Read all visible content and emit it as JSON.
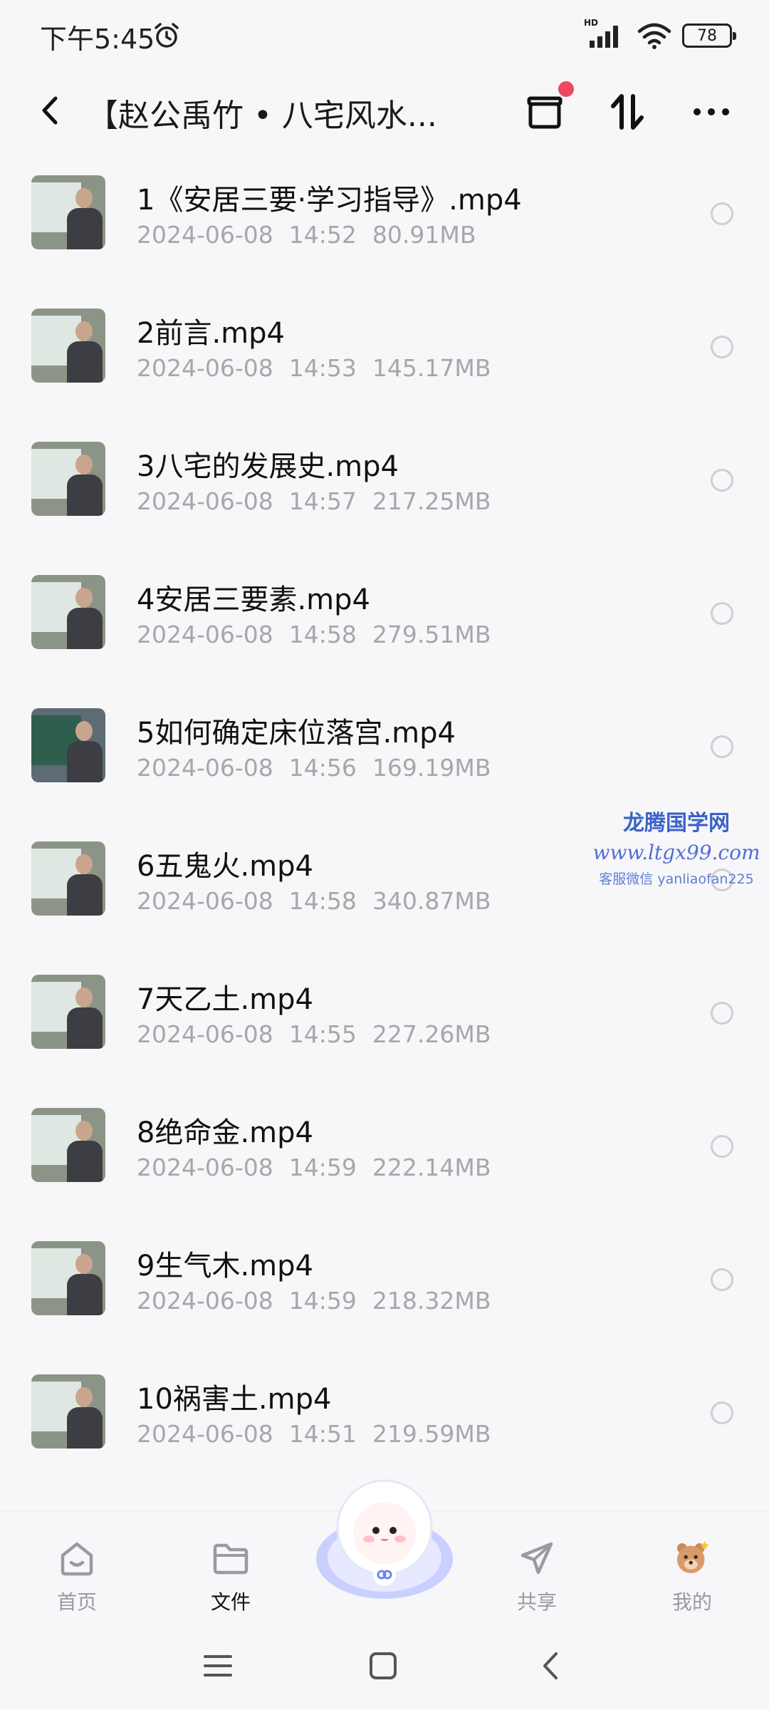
{
  "status_bar": {
    "time": "下午5:45",
    "network_label": "HD",
    "battery": "78"
  },
  "header": {
    "title": "【赵公禹竹 • 八宅风水...",
    "icons": [
      "back-arrow-icon",
      "archive-box-icon",
      "sort-icon",
      "more-icon"
    ],
    "badge_color": "#f0485f"
  },
  "files": [
    {
      "name": "1《安居三要·学习指导》.mp4",
      "date": "2024-06-08",
      "time": "14:52",
      "size": "80.91MB"
    },
    {
      "name": "2前言.mp4",
      "date": "2024-06-08",
      "time": "14:53",
      "size": "145.17MB"
    },
    {
      "name": "3八宅的发展史.mp4",
      "date": "2024-06-08",
      "time": "14:57",
      "size": "217.25MB"
    },
    {
      "name": "4安居三要素.mp4",
      "date": "2024-06-08",
      "time": "14:58",
      "size": "279.51MB"
    },
    {
      "name": "5如何确定床位落宫.mp4",
      "date": "2024-06-08",
      "time": "14:56",
      "size": "169.19MB"
    },
    {
      "name": "6五鬼火.mp4",
      "date": "2024-06-08",
      "time": "14:58",
      "size": "340.87MB"
    },
    {
      "name": "7天乙土.mp4",
      "date": "2024-06-08",
      "time": "14:55",
      "size": "227.26MB"
    },
    {
      "name": "8绝命金.mp4",
      "date": "2024-06-08",
      "time": "14:59",
      "size": "222.14MB"
    },
    {
      "name": "9生气木.mp4",
      "date": "2024-06-08",
      "time": "14:59",
      "size": "218.32MB"
    },
    {
      "name": "10祸害土.mp4",
      "date": "2024-06-08",
      "time": "14:51",
      "size": "219.59MB"
    }
  ],
  "watermark": {
    "title": "龙腾国学网",
    "url": "www.ltgx99.com",
    "contact": "客服微信 yanliaofan225"
  },
  "bottom_nav": {
    "home": "首页",
    "files": "文件",
    "share": "共享",
    "mine": "我的"
  },
  "colors": {
    "background": "#f7f7f9",
    "meta_text": "#a7a7ab",
    "watermark": "#3a63c7"
  }
}
